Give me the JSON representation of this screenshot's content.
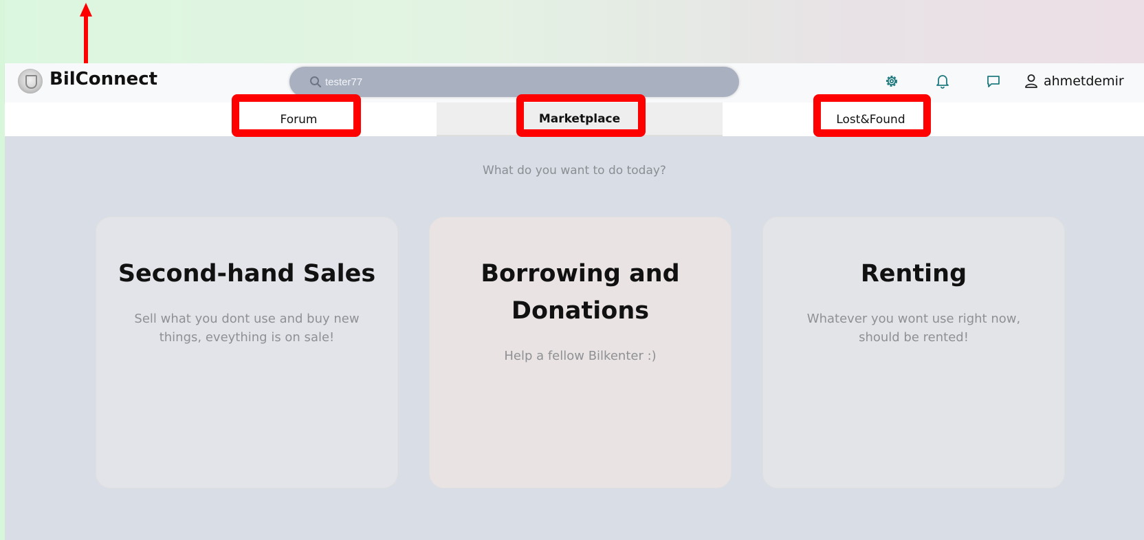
{
  "app": {
    "title": "BilConnect"
  },
  "search": {
    "value": "tester77"
  },
  "header": {
    "icons": [
      "settings-gear-icon",
      "bell-icon",
      "chat-icon",
      "user-icon"
    ],
    "username": "ahmetdemir",
    "accent_color": "#1f7a80"
  },
  "tabs": [
    {
      "label": "Forum",
      "active": false
    },
    {
      "label": "Marketplace",
      "active": true
    },
    {
      "label": "Lost&Found",
      "active": false
    }
  ],
  "prompt": "What do you want to do today?",
  "cards": [
    {
      "title": "Second-hand Sales",
      "description": "Sell what you dont use and buy new things, eveything is on sale!",
      "background": "#e3e4e9"
    },
    {
      "title": "Borrowing and Donations",
      "description": "Help a fellow Bilkenter :)",
      "background": "#e9e4e3"
    },
    {
      "title": "Renting",
      "description": "Whatever you wont use right now, should be rented!",
      "background": "#e3e4e8"
    }
  ],
  "annotations": {
    "highlight_color": "#ff0000"
  }
}
